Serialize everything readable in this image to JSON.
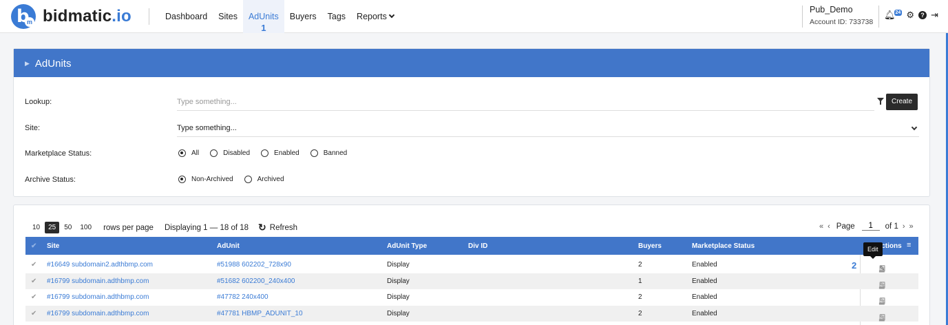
{
  "brand": {
    "name": "bidmatic",
    "suffix": ".io",
    "logo_letter": "b",
    "logo_mark": "m"
  },
  "nav": {
    "items": [
      {
        "label": "Dashboard"
      },
      {
        "label": "Sites"
      },
      {
        "label": "AdUnits",
        "marker": "1"
      },
      {
        "label": "Buyers"
      },
      {
        "label": "Tags"
      },
      {
        "label": "Reports"
      }
    ]
  },
  "account": {
    "name": "Pub_Demo",
    "id": "Account ID: 733738"
  },
  "notifications": {
    "count": "24"
  },
  "filters": {
    "title": "AdUnits",
    "lookup": {
      "label": "Lookup:",
      "placeholder": "Type something..."
    },
    "create_label": "Create",
    "site": {
      "label": "Site:",
      "value": "Type something..."
    },
    "marketplace": {
      "label": "Marketplace Status:",
      "options": [
        "All",
        "Disabled",
        "Enabled",
        "Banned"
      ],
      "selected": "All"
    },
    "archive": {
      "label": "Archive Status:",
      "options": [
        "Non-Archived",
        "Archived"
      ],
      "selected": "Non-Archived"
    }
  },
  "table": {
    "page_sizes": [
      "10",
      "25",
      "50",
      "100"
    ],
    "selected_page_size": "25",
    "rows_per_page_label": "rows per page",
    "displaying": "Displaying 1 — 18 of 18",
    "refresh_label": "Refresh",
    "pager": {
      "first": "«",
      "prev": "‹",
      "label": "Page",
      "page": "1",
      "of": "of 1",
      "next": "›",
      "last": "»"
    },
    "columns": {
      "site": "Site",
      "adunit": "AdUnit",
      "type": "AdUnit Type",
      "div": "Div ID",
      "buyers": "Buyers",
      "status": "Marketplace Status",
      "actions": "Actions"
    },
    "tooltip": "Edit",
    "marker": "2",
    "rows": [
      {
        "site": "#16649 subdomain2.adthbmp.com",
        "adunit": "#51988 602202_728x90",
        "type": "Display",
        "div": "",
        "buyers": "2",
        "status": "Enabled"
      },
      {
        "site": "#16799 subdomain.adthbmp.com",
        "adunit": "#51682 602200_240x400",
        "type": "Display",
        "div": "",
        "buyers": "1",
        "status": "Enabled"
      },
      {
        "site": "#16799 subdomain.adthbmp.com",
        "adunit": "#47782 240x400",
        "type": "Display",
        "div": "",
        "buyers": "2",
        "status": "Enabled"
      },
      {
        "site": "#16799 subdomain.adthbmp.com",
        "adunit": "#47781 HBMP_ADUNIT_10",
        "type": "Display",
        "div": "",
        "buyers": "2",
        "status": "Enabled"
      }
    ]
  },
  "colors": {
    "accent": "#3a7bd5",
    "header_bar": "#4176c9"
  }
}
